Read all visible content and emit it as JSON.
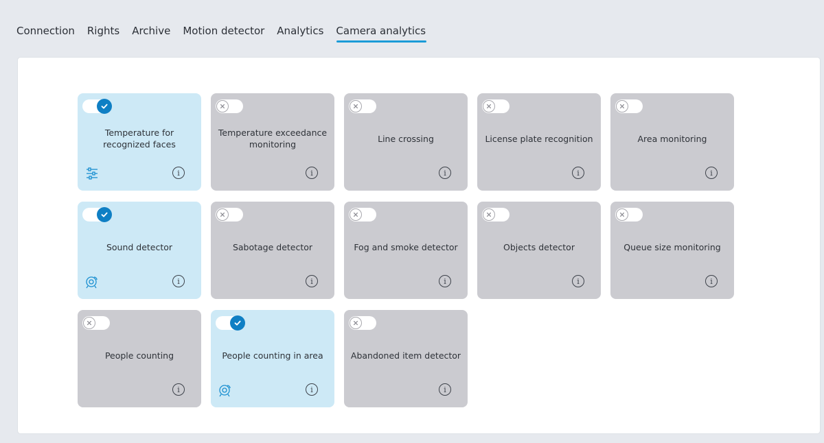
{
  "tabs": [
    {
      "label": "Connection",
      "active": false
    },
    {
      "label": "Rights",
      "active": false
    },
    {
      "label": "Archive",
      "active": false
    },
    {
      "label": "Motion detector",
      "active": false
    },
    {
      "label": "Analytics",
      "active": false
    },
    {
      "label": "Camera analytics",
      "active": true
    }
  ],
  "colors": {
    "accent": "#1a9bd7",
    "card_enabled": "#cde9f6",
    "card_disabled": "#cbcbd0",
    "toggle_on": "#0f7fc4"
  },
  "cards": [
    {
      "label": "Temperature for recognized faces",
      "enabled": true,
      "settings_icon": "sliders-icon"
    },
    {
      "label": "Temperature exceedance monitoring",
      "enabled": false,
      "settings_icon": null
    },
    {
      "label": "Line crossing",
      "enabled": false,
      "settings_icon": null
    },
    {
      "label": "License plate recognition",
      "enabled": false,
      "settings_icon": null
    },
    {
      "label": "Area monitoring",
      "enabled": false,
      "settings_icon": null
    },
    {
      "label": "Sound detector",
      "enabled": true,
      "settings_icon": "camera-settings-icon"
    },
    {
      "label": "Sabotage detector",
      "enabled": false,
      "settings_icon": null
    },
    {
      "label": "Fog and smoke detector",
      "enabled": false,
      "settings_icon": null
    },
    {
      "label": "Objects detector",
      "enabled": false,
      "settings_icon": null
    },
    {
      "label": "Queue size monitoring",
      "enabled": false,
      "settings_icon": null
    },
    {
      "label": "People counting",
      "enabled": false,
      "settings_icon": null
    },
    {
      "label": "People counting in area",
      "enabled": true,
      "settings_icon": "camera-settings-icon"
    },
    {
      "label": "Abandoned item detector",
      "enabled": false,
      "settings_icon": null
    }
  ],
  "info_glyph": "i"
}
